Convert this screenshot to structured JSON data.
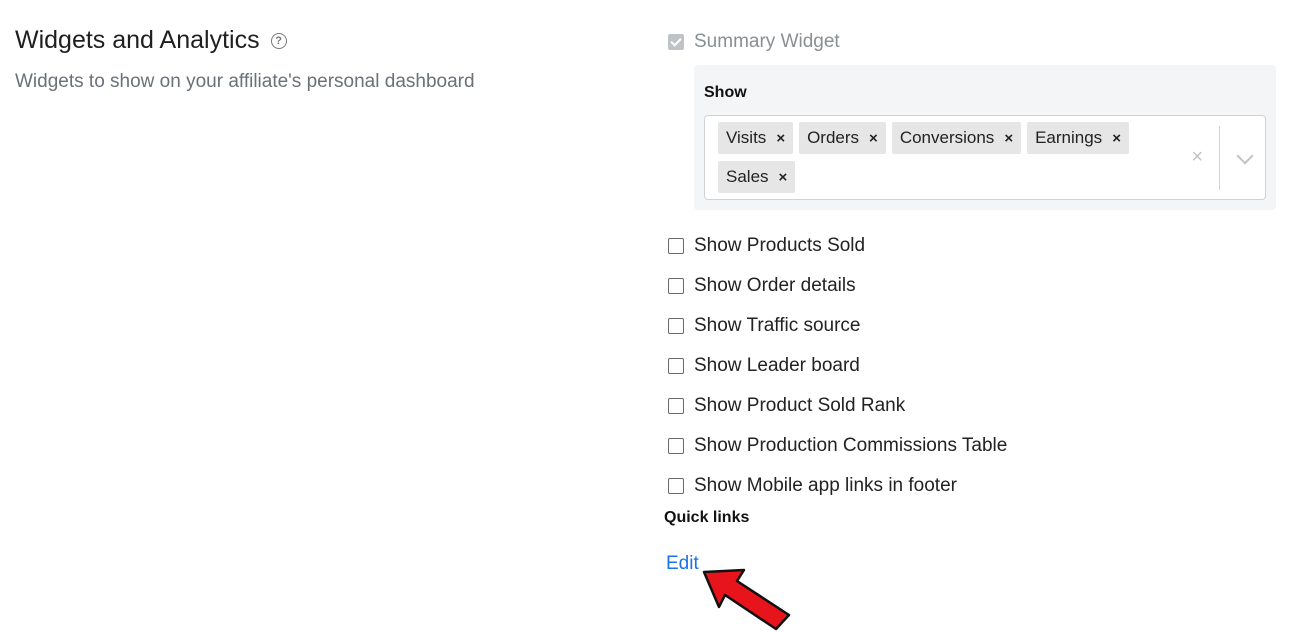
{
  "section": {
    "title": "Widgets and Analytics",
    "description": "Widgets to show on your affiliate's personal dashboard"
  },
  "summary_widget": {
    "label": "Summary Widget",
    "checked": true
  },
  "show": {
    "label": "Show",
    "tags": [
      {
        "label": "Visits",
        "remove": "×"
      },
      {
        "label": "Orders",
        "remove": "×"
      },
      {
        "label": "Conversions",
        "remove": "×"
      },
      {
        "label": "Earnings",
        "remove": "×"
      },
      {
        "label": "Sales",
        "remove": "×"
      }
    ],
    "clear": "×"
  },
  "options": [
    {
      "label": "Show Products Sold",
      "checked": false
    },
    {
      "label": "Show Order details",
      "checked": false
    },
    {
      "label": "Show Traffic source",
      "checked": false
    },
    {
      "label": "Show Leader board",
      "checked": false
    },
    {
      "label": "Show Product Sold Rank",
      "checked": false
    },
    {
      "label": "Show Production Commissions Table",
      "checked": false
    },
    {
      "label": "Show Mobile app links in footer",
      "checked": false
    }
  ],
  "quick_links": {
    "label": "Quick links",
    "edit": "Edit"
  },
  "colors": {
    "link": "#1a73e8",
    "annotation_arrow": "#e8141c"
  }
}
